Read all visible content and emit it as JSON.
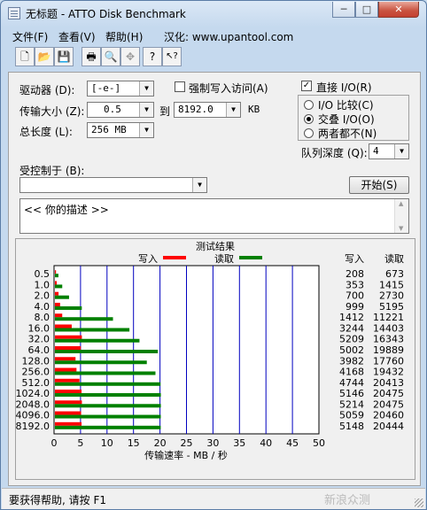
{
  "window": {
    "title": "无标题 - ATTO Disk Benchmark",
    "min": "─",
    "max": "□",
    "close": "✕"
  },
  "menu": {
    "file": "文件(F)",
    "view": "查看(V)",
    "help": "帮助(H)",
    "credit": "汉化: www.upantool.com"
  },
  "toolbar": [
    {
      "name": "new-file-icon",
      "glyph": "🗋"
    },
    {
      "name": "open-folder-icon",
      "glyph": "📂"
    },
    {
      "name": "save-icon",
      "glyph": "💾"
    },
    {
      "name": "print-icon",
      "glyph": "🖶"
    },
    {
      "name": "print-preview-icon",
      "glyph": "🔍"
    },
    {
      "name": "move-icon",
      "glyph": "✥"
    },
    {
      "name": "help-icon",
      "glyph": "?"
    },
    {
      "name": "context-help-icon",
      "glyph": "↖?"
    }
  ],
  "form": {
    "drive_label": "驱动器 (D):",
    "drive_value": "[-e-]",
    "force_write_label": "强制写入访问(A)",
    "transfer_label": "传输大小 (Z):",
    "transfer_from": "0.5",
    "to_label": "到",
    "transfer_to": "8192.0",
    "kb_label": "KB",
    "length_label": "总长度 (L):",
    "length_value": "256 MB",
    "controlled_label": "受控制于 (B):",
    "controlled_value": "",
    "direct_io_label": "直接 I/O(R)",
    "radio_compare": "I/O 比较(C)",
    "radio_overlap": "交叠 I/O(O)",
    "radio_neither": "两者都不(N)",
    "queue_label": "队列深度 (Q):",
    "queue_value": "4",
    "start_button": "开始(S)",
    "description": "<<  你的描述   >>"
  },
  "chart_data": {
    "type": "bar",
    "title": "测试结果",
    "legend": {
      "write": "写入",
      "read": "读取"
    },
    "colors": {
      "write": "#ff0000",
      "read": "#008000",
      "grid": "#0000c0"
    },
    "categories": [
      "0.5",
      "1.0",
      "2.0",
      "4.0",
      "8.0",
      "16.0",
      "32.0",
      "64.0",
      "128.0",
      "256.0",
      "512.0",
      "1024.0",
      "2048.0",
      "4096.0",
      "8192.0"
    ],
    "series": [
      {
        "name": "写入",
        "values": [
          208,
          353,
          700,
          999,
          1412,
          3244,
          5209,
          5002,
          3982,
          4168,
          4744,
          5146,
          5214,
          5059,
          5148
        ]
      },
      {
        "name": "读取",
        "values": [
          673,
          1415,
          2730,
          5195,
          11221,
          14403,
          16343,
          19889,
          17760,
          19432,
          20413,
          20475,
          20475,
          20460,
          20444
        ]
      }
    ],
    "write_col": [
      "208",
      "353",
      "700",
      "999",
      "1412",
      "3244",
      "5209",
      "5002",
      "3982",
      "4168",
      "4744",
      "5146",
      "5214",
      "5059",
      "5148"
    ],
    "read_col": [
      "673",
      "1415",
      "2730",
      "5195",
      "11221",
      "14403",
      "16343",
      "19889",
      "17760",
      "19432",
      "20413",
      "20475",
      "20475",
      "20460",
      "20444"
    ],
    "xticks": [
      "0",
      "5",
      "10",
      "15",
      "20",
      "25",
      "30",
      "35",
      "40",
      "45",
      "50"
    ],
    "xlim": [
      0,
      50
    ],
    "xlabel": "传输速率 - MB / 秒",
    "col_write": "写入",
    "col_read": "读取"
  },
  "status": {
    "text": "要获得帮助, 请按 F1",
    "watermark": "新浪众测"
  }
}
